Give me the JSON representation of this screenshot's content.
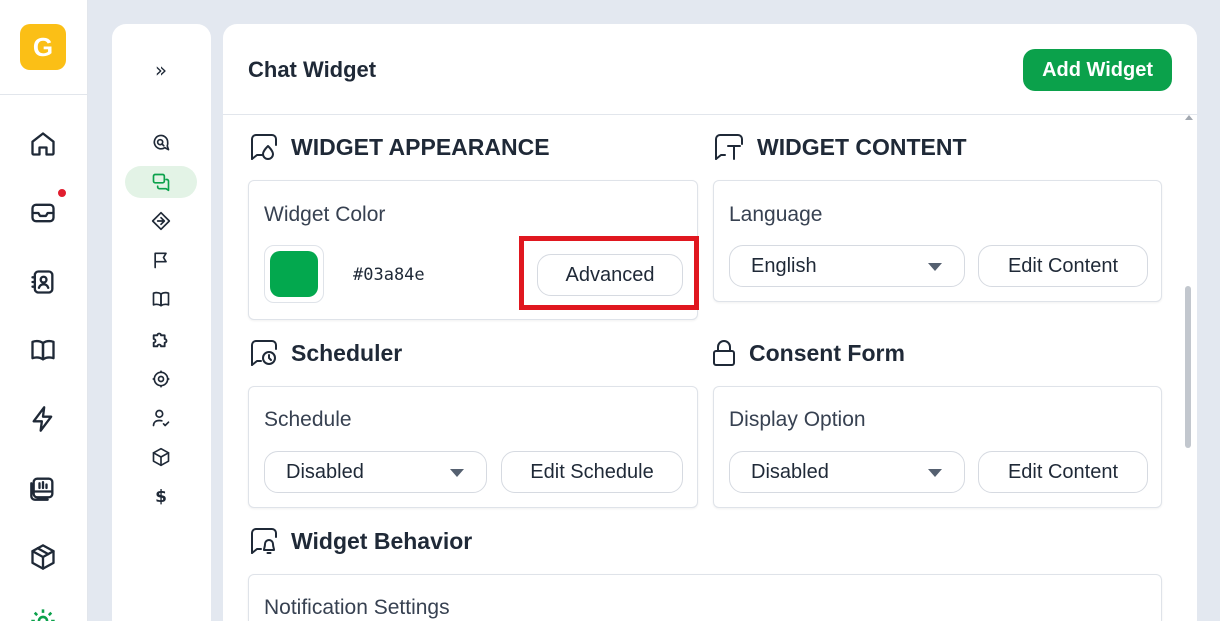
{
  "app": {
    "logo_letter": "G"
  },
  "left_rail": {
    "items": [
      {
        "name": "home-icon"
      },
      {
        "name": "inbox-icon",
        "has_notification": true
      },
      {
        "name": "contacts-icon"
      },
      {
        "name": "book-icon"
      },
      {
        "name": "lightning-icon"
      },
      {
        "name": "reports-icon"
      },
      {
        "name": "box-icon"
      },
      {
        "name": "settings-icon"
      }
    ]
  },
  "sub_rail": {
    "expand_label": "»",
    "items": [
      {
        "name": "chat-search-icon"
      },
      {
        "name": "chat-widget-icon",
        "active": true
      },
      {
        "name": "integration-icon"
      },
      {
        "name": "flag-icon"
      },
      {
        "name": "book-icon"
      },
      {
        "name": "puzzle-icon"
      },
      {
        "name": "gear-icon"
      },
      {
        "name": "user-check-icon"
      },
      {
        "name": "package-icon"
      },
      {
        "name": "billing-icon",
        "symbol": "$"
      }
    ]
  },
  "header": {
    "title": "Chat Widget",
    "add_button": "Add Widget"
  },
  "sections": {
    "appearance": {
      "title": "WIDGET APPEARANCE",
      "label": "Widget Color",
      "hex_value": "#03a84e",
      "advanced_button": "Advanced"
    },
    "content": {
      "title": "WIDGET CONTENT",
      "label": "Language",
      "language_value": "English",
      "edit_button": "Edit Content"
    },
    "scheduler": {
      "title": "Scheduler",
      "label": "Schedule",
      "schedule_value": "Disabled",
      "edit_button": "Edit Schedule"
    },
    "consent": {
      "title": "Consent Form",
      "label": "Display Option",
      "display_value": "Disabled",
      "edit_button": "Edit Content"
    },
    "behavior": {
      "title": "Widget Behavior",
      "label": "Notification Settings"
    }
  },
  "colors": {
    "brand_green": "#0ba14b",
    "widget_color": "#03a84e",
    "highlight_red": "#e0171f",
    "logo_yellow": "#fbbf16"
  }
}
